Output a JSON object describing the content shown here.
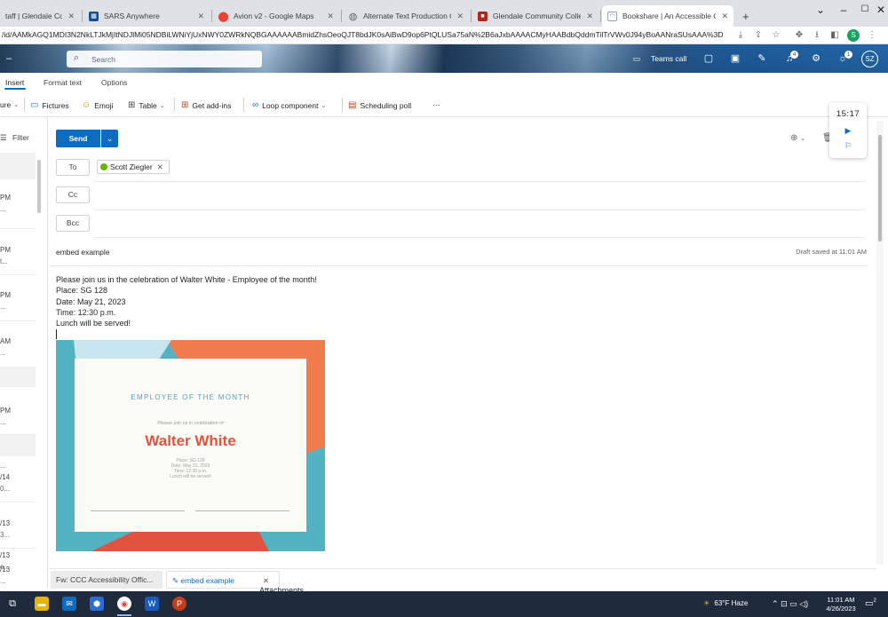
{
  "browser": {
    "tabs": [
      {
        "label": "taff | Glendale Comm",
        "favicon_color": "#d0d0d0"
      },
      {
        "label": "SARS Anywhere",
        "favicon_color": "#1a4d8f"
      },
      {
        "label": "Avion v2 - Google Maps",
        "favicon_color": "#34a853"
      },
      {
        "label": "Alternate Text Production Cente",
        "favicon_color": "#5f6368"
      },
      {
        "label": "Glendale Community College |",
        "favicon_color": "#b3261e"
      },
      {
        "label": "Bookshare | An Accessible Onlin",
        "favicon_color": "#ffffff"
      }
    ],
    "new_tab_label": "+",
    "url": "/id/AAMkAGQ1MDI3N2NkLTJkMjItNDJlMi05NDBiLWNiYjUxNWY0ZWRkNQBGAAAAAABmidZhsOeoQJT8bdJK0sAiBwD9op6PtQLUSa75aN%2B6aJxbAAAACMyHAABdbQddmTilTrVWv0J94yBoAANraSUsAAA%3D",
    "profile_initial": "S"
  },
  "outlook": {
    "search_placeholder": "Search",
    "teams_call_label": "Teams call",
    "badges": {
      "notifications": "4",
      "whatsnew": "1"
    },
    "user_initials": "SZ"
  },
  "ribbon": {
    "tabs": [
      "Insert",
      "Format text",
      "Options"
    ],
    "toolbar": {
      "picture_partial": "ure",
      "pictures": "Fictures",
      "emoji": "Emoji",
      "table": "Table",
      "get_addins": "Get add-ins",
      "loop": "Loop component",
      "scheduling": "Scheduling poll",
      "more": "···"
    }
  },
  "message_list": {
    "filter_label": "Filter",
    "items": [
      {
        "time": "PM",
        "sub": "..."
      },
      {
        "time": "PM",
        "sub": "t..."
      },
      {
        "time": "PM",
        "sub": "..."
      },
      {
        "time": "AM",
        "sub": "..."
      },
      {
        "time": "PM",
        "sub": "..."
      },
      {
        "time": "/14",
        "sub": "0..."
      },
      {
        "time": "/13",
        "sub": "3..."
      },
      {
        "time": "/13",
        "sub": "e..."
      },
      {
        "time": "/13",
        "sub": "..."
      }
    ]
  },
  "compose": {
    "send_label": "Send",
    "to_label": "To",
    "cc_label": "Cc",
    "bcc_label": "Bcc",
    "recipient": "Scott Ziegler",
    "subject": "embed example",
    "draft_saved": "Draft saved at 11:01 AM",
    "body": [
      "Please join us in the celebration of Walter White - Employee of the month!",
      "Place: SG 128",
      "Date: May 21, 2023",
      "Time: 12:30 p.m.",
      "Lunch will be served!"
    ]
  },
  "certificate": {
    "heading": "EMPLOYEE OF THE MONTH",
    "invite": "Please join us in celebration of",
    "name": "Walter White",
    "details": [
      "Place: SG 128",
      "Date: May 21, 2023",
      "Time: 12:30 p.m.",
      "Lunch will be served!"
    ],
    "colors": {
      "teal": "#54b3c3",
      "orange": "#f07b4c",
      "light_blue": "#c8e6ef",
      "red": "#e0543f"
    }
  },
  "timer": {
    "time": "15:17"
  },
  "bottom_tabs": {
    "draft1": "Fw: CCC Accessibility Offic...",
    "draft2": "embed example",
    "attachments": "Attachments"
  },
  "taskbar": {
    "weather": "63°F  Haze",
    "time": "11:01 AM",
    "date": "4/26/2023",
    "notifications": "2"
  }
}
